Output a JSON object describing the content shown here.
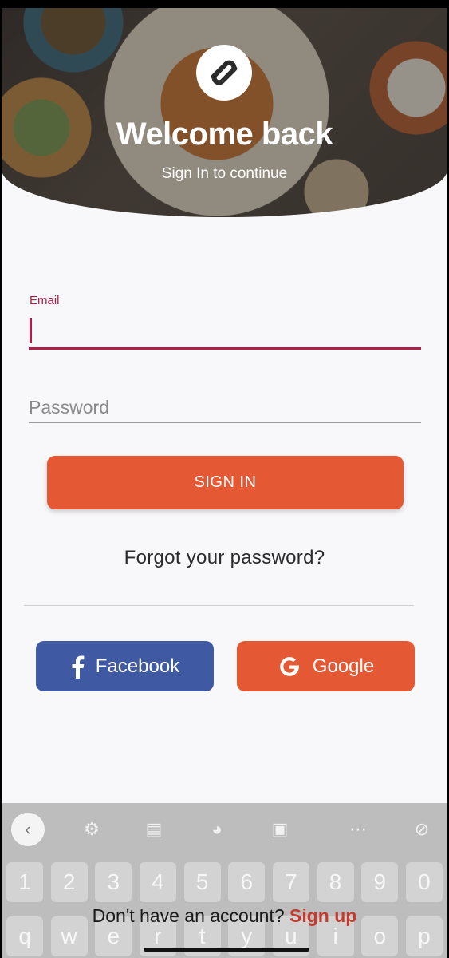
{
  "header": {
    "title": "Welcome back",
    "subtitle": "Sign In to continue",
    "logo_icon": "chain-link-logo-icon"
  },
  "form": {
    "email_label": "Email",
    "email_value": "",
    "password_placeholder": "Password",
    "signin_label": "SIGN IN",
    "forgot_label": "Forgot your password?"
  },
  "social": {
    "facebook_label": "Facebook",
    "google_label": "Google"
  },
  "signup": {
    "prompt": "Don't have an account?",
    "link": "Sign up"
  },
  "keyboard": {
    "toolbar": [
      "back-icon",
      "settings-icon",
      "translate-icon",
      "palette-icon",
      "clipboard-icon",
      "more-icon",
      "mic-off-icon"
    ],
    "number_row": [
      "1",
      "2",
      "3",
      "4",
      "5",
      "6",
      "7",
      "8",
      "9",
      "0"
    ],
    "letter_row": [
      "q",
      "w",
      "e",
      "r",
      "t",
      "y",
      "u",
      "i",
      "o",
      "p"
    ]
  },
  "colors": {
    "accent": "#e55834",
    "focus": "#b01f45",
    "facebook": "#3f5aa2"
  }
}
